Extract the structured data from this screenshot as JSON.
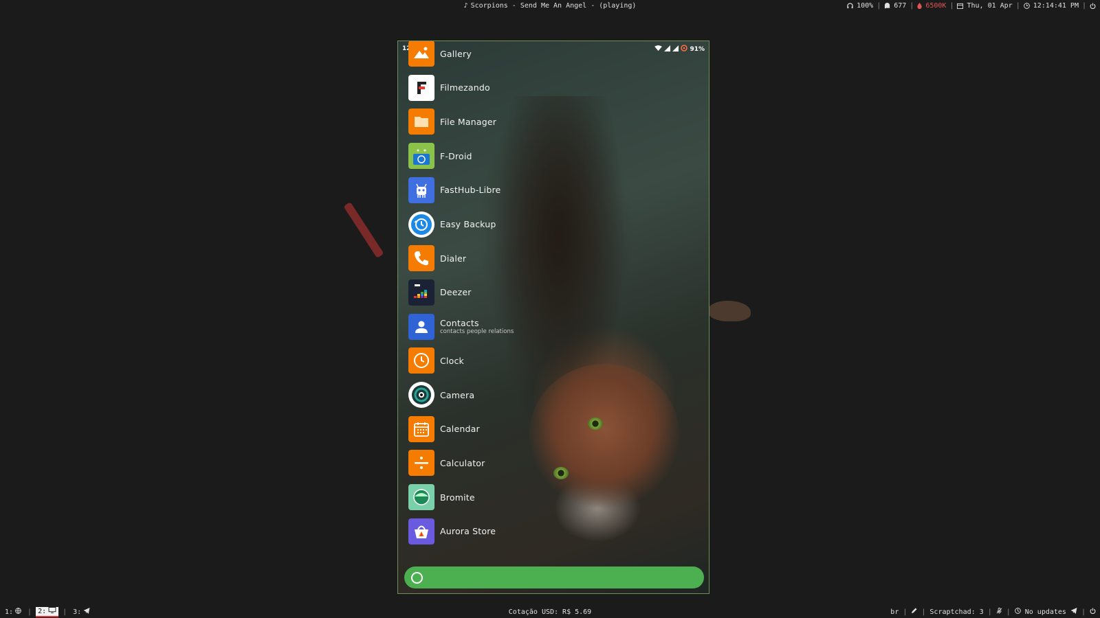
{
  "topbar": {
    "now_playing": "Scorpions - Send Me An Angel - (playing)",
    "volume": "100%",
    "ghost_count": "677",
    "color_temp": "6500K",
    "date": "Thu, 01 Apr",
    "time": "12:14:41 PM"
  },
  "bottombar": {
    "workspaces": [
      {
        "label": "1:",
        "icon": "globe-icon"
      },
      {
        "label": "2:",
        "icon": "monitor-icon"
      },
      {
        "label": "3:",
        "icon": "telegram-icon"
      }
    ],
    "quote": "Cotação USD: R$ 5.69",
    "keyboard_layout": "br",
    "scratchpad": "Scraptchad: 3",
    "updates": "No updates"
  },
  "phone": {
    "status": {
      "time": "12:14",
      "battery": "91%"
    },
    "apps": [
      {
        "name": "Gallery",
        "tags": "",
        "icon": "gallery-icon",
        "color": "#f57c00"
      },
      {
        "name": "Filmezando",
        "tags": "",
        "icon": "filmezando-icon",
        "color": "#ffffff"
      },
      {
        "name": "File Manager",
        "tags": "",
        "icon": "folder-icon",
        "color": "#f57c00"
      },
      {
        "name": "F-Droid",
        "tags": "",
        "icon": "fdroid-icon",
        "color": "#8bc34a"
      },
      {
        "name": "FastHub-Libre",
        "tags": "",
        "icon": "fasthub-icon",
        "color": "#3f6fe0"
      },
      {
        "name": "Easy Backup",
        "tags": "",
        "icon": "backup-icon",
        "color": "#ffffff"
      },
      {
        "name": "Dialer",
        "tags": "",
        "icon": "phone-icon",
        "color": "#f57c00"
      },
      {
        "name": "Deezer",
        "tags": "",
        "icon": "deezer-icon",
        "color": "#1b2236"
      },
      {
        "name": "Contacts",
        "tags": "contacts people relations",
        "icon": "contacts-icon",
        "color": "#2f63d6"
      },
      {
        "name": "Clock",
        "tags": "",
        "icon": "clock-icon",
        "color": "#f57c00"
      },
      {
        "name": "Camera",
        "tags": "",
        "icon": "camera-icon",
        "color": "#ffffff"
      },
      {
        "name": "Calendar",
        "tags": "",
        "icon": "calendar-icon",
        "color": "#f57c00"
      },
      {
        "name": "Calculator",
        "tags": "",
        "icon": "calculator-icon",
        "color": "#f57c00"
      },
      {
        "name": "Bromite",
        "tags": "",
        "icon": "bromite-icon",
        "color": "#7ad1a9"
      },
      {
        "name": "Aurora Store",
        "tags": "",
        "icon": "aurora-icon",
        "color": "#6a5ae0"
      }
    ],
    "search_color": "#4caf50"
  }
}
